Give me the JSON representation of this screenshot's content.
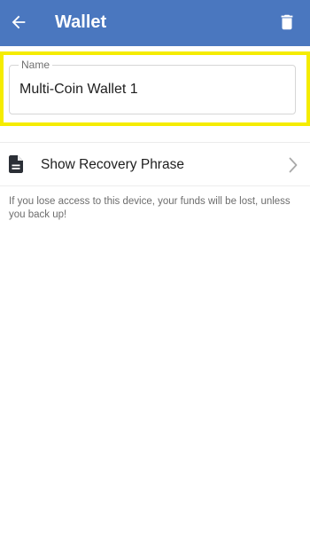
{
  "appbar": {
    "title": "Wallet",
    "back_icon": "arrow-left-icon",
    "delete_icon": "trash-icon",
    "color": "#4a77bf"
  },
  "name_field": {
    "label": "Name",
    "value": "Multi-Coin Wallet 1",
    "highlight_color": "#f5ec00"
  },
  "recovery": {
    "icon": "document-icon",
    "label": "Show Recovery Phrase",
    "chevron_icon": "chevron-right-icon"
  },
  "warning_text": "If you lose access to this device, your funds will be lost, unless you back up!"
}
